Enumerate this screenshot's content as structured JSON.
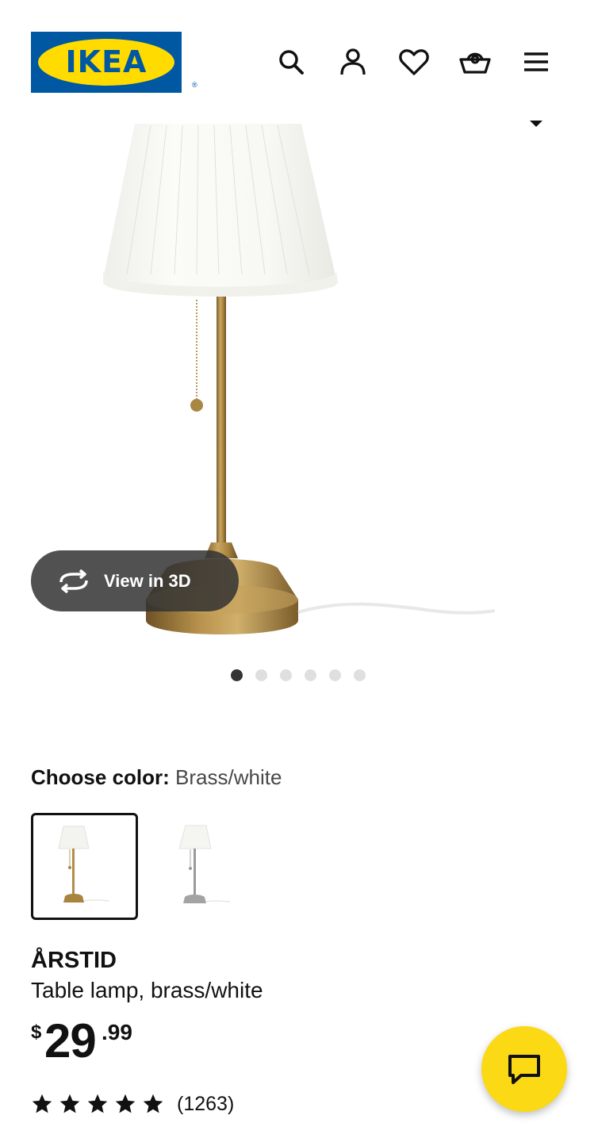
{
  "header": {
    "logo_text": "IKEA",
    "logo_registered": "®",
    "brand_colors": {
      "blue": "#0058a3",
      "yellow": "#ffdb00"
    },
    "icons": [
      "search-icon",
      "profile-icon",
      "heart-icon",
      "cart-icon",
      "menu-icon"
    ]
  },
  "gallery": {
    "view_3d_label": "View in 3D",
    "image_count": 6,
    "active_index": 0
  },
  "color_choice": {
    "label": "Choose color:",
    "selected": "Brass/white",
    "options": [
      "brass-white",
      "nickel-white"
    ]
  },
  "product": {
    "name": "ÅRSTID",
    "description": "Table lamp, brass/white",
    "price": {
      "currency": "$",
      "integer": "29",
      "decimal": ".99"
    },
    "rating": {
      "stars": 5,
      "count": "(1263)"
    }
  },
  "chat": {
    "icon": "chat-icon",
    "color": "#fbd914"
  }
}
